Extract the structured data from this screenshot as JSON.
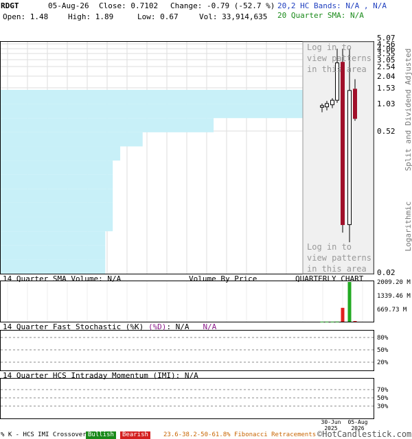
{
  "header": {
    "symbol": "RDGT",
    "date": "05-Aug-26",
    "close": "Close: 0.7102",
    "change": "Change: -0.79 (-52.7 %)",
    "bands": "20,2 HC Bands: N/A , N/A",
    "open": "Open: 1.48",
    "high": "High: 1.89",
    "low": "Low: 0.67",
    "vol": "Vol: 33,914,635",
    "sma": "20 Quarter SMA: N/A"
  },
  "price_panel": {
    "right_label": "Split and Dividend Adjusted",
    "scale_label": "Logarithmic",
    "patterns_msg": "Log in to\nview patterns\nin this area",
    "patterns_msg_2": "Log in to\nview patterns\nin this area"
  },
  "volume_panel": {
    "sma_label": "14 Quarter SMA Volume: N/A",
    "vbp_label": "Volume By Price",
    "chart_label": "QUARTERLY CHART"
  },
  "stoch_panel": {
    "label": "14 Quarter Fast Stochastic (%K) (%D): N/A",
    "label_k": "14 Quarter Fast Stochastic (%K)",
    "label_d": "(%D)",
    "label_na": ": N/A",
    "label_na2": "N/A"
  },
  "imi_panel": {
    "label": "14 Quarter HCS Intraday Momentum (IMI): N/A"
  },
  "footer": {
    "crossover": "% K - HCS IMI Crossover,",
    "bullish": "Bullish",
    "bearish": "Bearish",
    "fib": "23.6-38.2-50-61.8% Fibonacci Retracements",
    "copyright": "©HotCandlestick.com"
  },
  "colors": {
    "bullish": "#1a8a1a",
    "bearish": "#d42020",
    "vbp": "#c8f0f8",
    "candle_up": "#ffffff",
    "candle_down": "#a0102a",
    "vol_bar": "#22aa22",
    "vol_bar_red": "#e02020"
  },
  "chart_data": [
    {
      "type": "candlestick",
      "title": "",
      "scale": "log",
      "ylim": [
        0.02,
        5.07
      ],
      "y_ticks": [
        "5.07",
        "4.56",
        "4.06",
        "3.55",
        "3.05",
        "2.54",
        "2.04",
        "1.53",
        "1.03",
        "0.52",
        "0.02"
      ],
      "y_tick_values": [
        5.07,
        4.56,
        4.06,
        3.55,
        3.05,
        2.54,
        2.04,
        1.53,
        1.03,
        0.52,
        0.02
      ],
      "candles": [
        {
          "open": 0.94,
          "high": 1.03,
          "low": 0.83,
          "close": 0.98
        },
        {
          "open": 0.95,
          "high": 1.1,
          "low": 0.87,
          "close": 1.03
        },
        {
          "open": 1.0,
          "high": 1.18,
          "low": 0.92,
          "close": 1.12
        },
        {
          "open": 1.12,
          "high": 4.06,
          "low": 1.05,
          "close": 2.8
        },
        {
          "open": 2.85,
          "high": 4.06,
          "low": 0.05,
          "close": 0.06
        },
        {
          "open": 0.06,
          "high": 4.06,
          "low": 0.04,
          "close": 1.43
        },
        {
          "open": 1.48,
          "high": 1.89,
          "low": 0.67,
          "close": 0.7102
        }
      ],
      "candle_direction": [
        "up",
        "up",
        "up",
        "up",
        "down",
        "up",
        "down"
      ],
      "volume_by_price": [
        0.91,
        0.81,
        0.57,
        0.38,
        0.32,
        0.3,
        0.3,
        0.3,
        0.3,
        0.3,
        0.28,
        0.28,
        0.28
      ]
    },
    {
      "type": "bar",
      "title": "",
      "y_ticks": [
        "2009.20 M",
        "1339.46 M",
        "669.73 M"
      ],
      "ylim": [
        0,
        2009.2
      ],
      "values": [
        4,
        5,
        5,
        8,
        700,
        2009.2,
        33.9
      ],
      "colors": [
        "green",
        "green",
        "green",
        "green",
        "red",
        "green",
        "red"
      ]
    },
    {
      "type": "line",
      "title": "",
      "y_ticks": [
        "80%",
        "50%",
        "20%"
      ],
      "ylim": [
        0,
        100
      ]
    },
    {
      "type": "line",
      "title": "",
      "y_ticks": [
        "70%",
        "50%",
        "30%"
      ],
      "ylim": [
        0,
        100
      ],
      "x_ticks": [
        "30-Jun\n2025",
        "05-Aug\n2026"
      ]
    }
  ]
}
